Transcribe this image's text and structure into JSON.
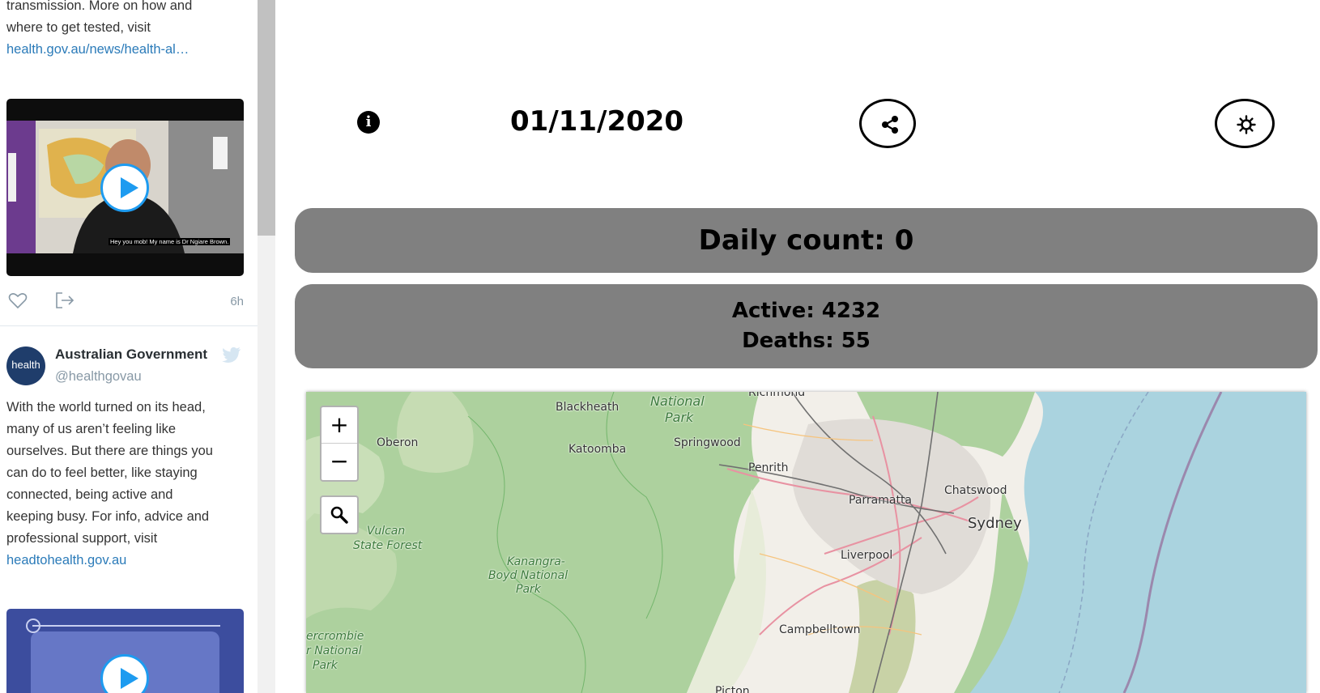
{
  "feed": {
    "tweet1": {
      "text_line1": "transmission. More on how and",
      "text_line2": "where to get tested, visit",
      "link": "health.gov.au/news/health-al…",
      "video_caption": "Hey you mob! My name is Dr Ngiare Brown.",
      "time": "6h"
    },
    "tweet2": {
      "avatar_text": "health",
      "author": "Australian Government",
      "handle": "@healthgovau",
      "lines": [
        "With the world turned on its head,",
        "many of us aren’t feeling like",
        "ourselves. But there are things you",
        "can do to feel better, like staying",
        "connected, being active and",
        "keeping busy. For info, advice and",
        "professional support, visit"
      ],
      "link": "headtohealth.gov.au"
    }
  },
  "header": {
    "info_icon": "info-icon",
    "date": "01/11/2020",
    "share_icon": "share-icon",
    "theme_icon": "sun-icon"
  },
  "stats": {
    "daily": "Daily count: 0",
    "active": "Active: 4232",
    "deaths": "Deaths: 55"
  },
  "map": {
    "zoom_in": "+",
    "zoom_out": "−",
    "search_icon": "search-icon",
    "labels": {
      "richmond": "Richmond",
      "blackheath": "Blackheath",
      "national": "National",
      "park": "Park",
      "oberon": "Oberon",
      "katoomba": "Katoomba",
      "springwood": "Springwood",
      "penrith": "Penrith",
      "chatswood": "Chatswood",
      "parramatta": "Parramatta",
      "sydney": "Sydney",
      "vulcan": "Vulcan",
      "state_forest": "State Forest",
      "kanangra": "Kanangra-",
      "boyd": "Boyd National",
      "park2": "Park",
      "liverpool": "Liverpool",
      "campbelltown": "Campbelltown",
      "abercrombie": "ercrombie",
      "abercrombie2": "r National",
      "park3": "Park",
      "picton": "Picton"
    }
  },
  "colors": {
    "stat_box": "#808080",
    "link": "#2b7bb9",
    "play": "#1d9bf0",
    "water": "#aad3df",
    "forest": "#add19e"
  }
}
